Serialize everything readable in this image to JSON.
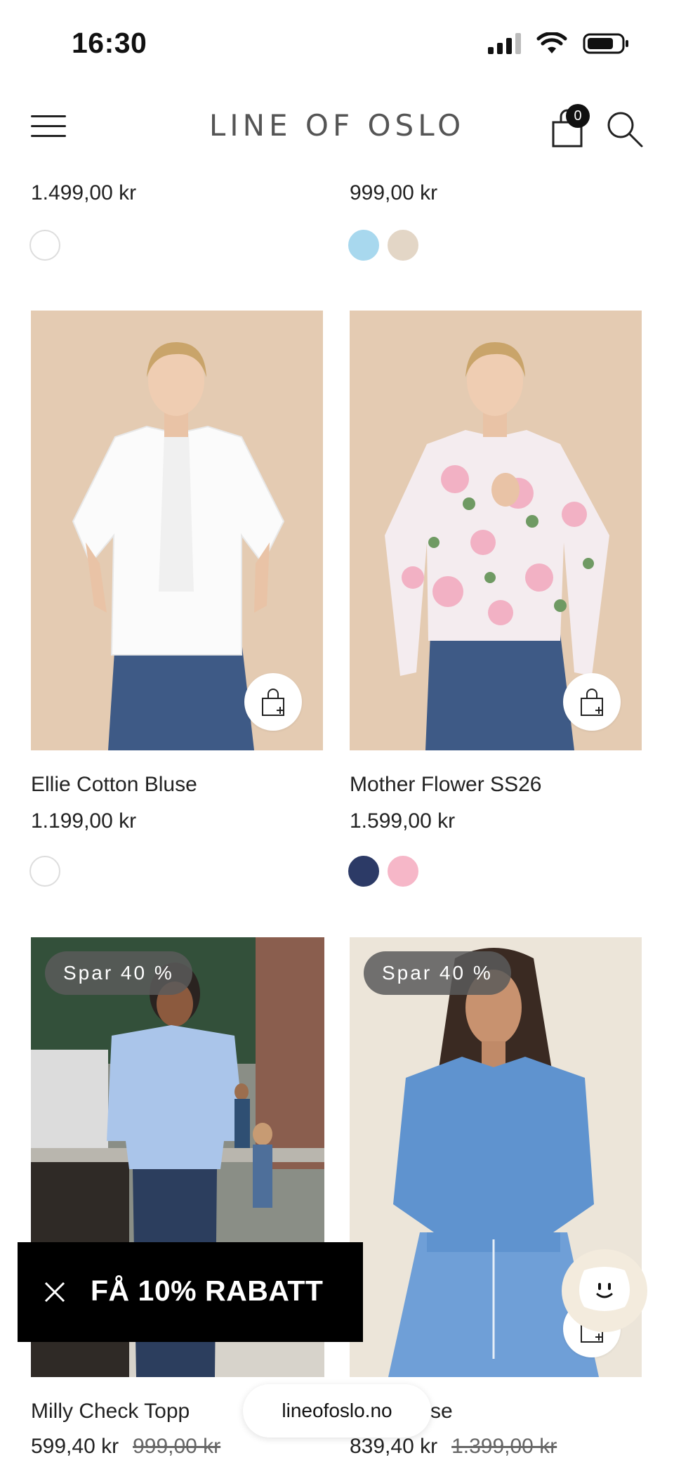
{
  "status_bar": {
    "time": "16:30"
  },
  "header": {
    "brand": "LINE OF OSLO",
    "cart_count": "0"
  },
  "top_row": [
    {
      "price": "1.499,00 kr",
      "swatches": [
        "#ffffff"
      ]
    },
    {
      "price": "999,00 kr",
      "swatches": [
        "#a8d8ee",
        "#e3d6c6"
      ]
    }
  ],
  "products": [
    {
      "name": "Ellie Cotton Bluse",
      "price": "1.199,00 kr",
      "swatches": [
        "#ffffff"
      ]
    },
    {
      "name": "Mother Flower SS26",
      "price": "1.599,00 kr",
      "swatches": [
        "#2c3a66",
        "#f6b7c8"
      ]
    },
    {
      "name": "Milly Check Topp",
      "price": "599,40 kr",
      "old_price": "999,00 kr",
      "badge": "Spar 40 %"
    },
    {
      "name": "...cel Bluse",
      "price": "839,40 kr",
      "old_price": "1.399,00 kr",
      "badge": "Spar 40 %"
    }
  ],
  "promo": {
    "label": "FÅ 10% RABATT"
  },
  "browser": {
    "url": "lineofoslo.no"
  },
  "colors": {
    "image_bg": "#e4cbb2",
    "denim": "#3e5a86",
    "accent_black": "#000000"
  }
}
